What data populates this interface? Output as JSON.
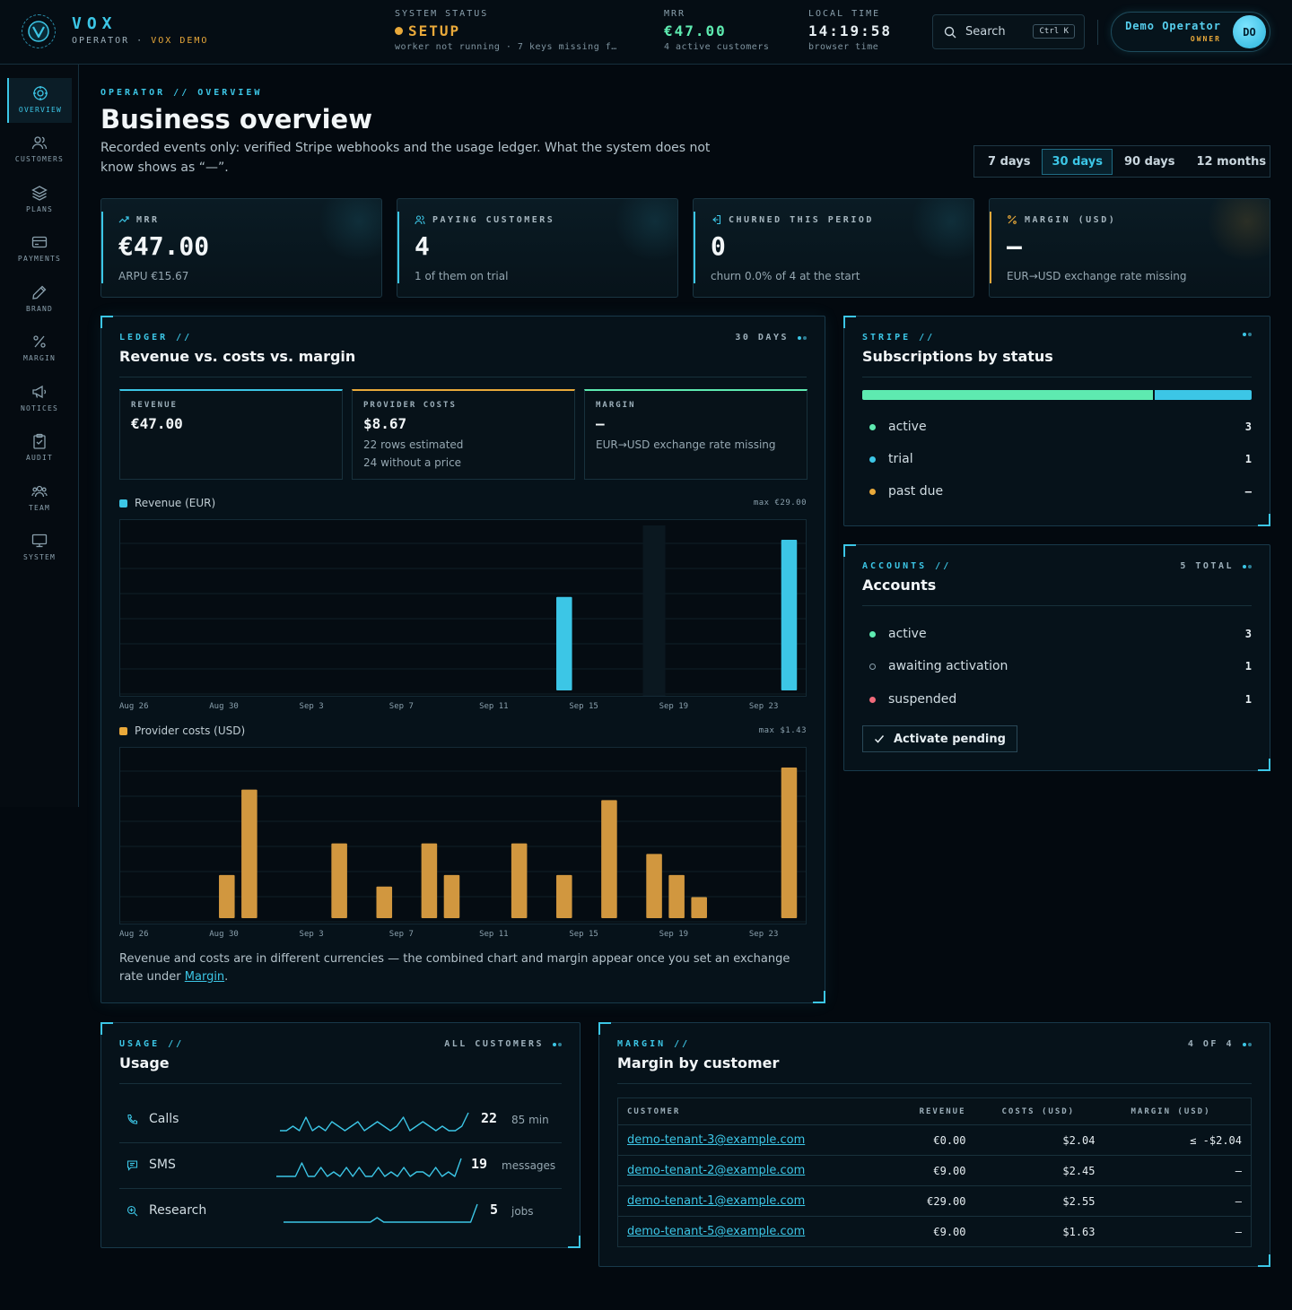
{
  "header": {
    "brand": "VOX",
    "brand_sub_prefix": "OPERATOR ·",
    "brand_sub_demo": "VOX DEMO",
    "system_status": {
      "label": "SYSTEM STATUS",
      "value": "SETUP",
      "sub": "worker not running · 7 keys missing f…",
      "color": "#e9a93a"
    },
    "mrr": {
      "label": "MRR",
      "value": "€47.00",
      "sub": "4 active customers"
    },
    "local_time": {
      "label": "LOCAL TIME",
      "value": "14:19:58",
      "sub": "browser time"
    },
    "search": {
      "label": "Search",
      "shortcut": "Ctrl K"
    },
    "user": {
      "name": "Demo Operator",
      "role": "OWNER",
      "initials": "DO"
    }
  },
  "sidebar": {
    "items": [
      {
        "label": "OVERVIEW",
        "icon": "target-icon",
        "active": true
      },
      {
        "label": "CUSTOMERS",
        "icon": "users-icon"
      },
      {
        "label": "PLANS",
        "icon": "layers-icon"
      },
      {
        "label": "PAYMENTS",
        "icon": "credit-card-icon"
      },
      {
        "label": "BRAND",
        "icon": "pen-icon"
      },
      {
        "label": "MARGIN",
        "icon": "percent-icon"
      },
      {
        "label": "NOTICES",
        "icon": "megaphone-icon"
      },
      {
        "label": "AUDIT",
        "icon": "clipboard-icon"
      },
      {
        "label": "TEAM",
        "icon": "team-icon"
      },
      {
        "label": "SYSTEM",
        "icon": "monitor-icon"
      }
    ]
  },
  "page": {
    "crumb": "OPERATOR // OVERVIEW",
    "title": "Business overview",
    "description": "Recorded events only: verified Stripe webhooks and the usage ledger. What the system does not know shows as “—”.",
    "ranges": [
      "7 days",
      "30 days",
      "90 days",
      "12 months"
    ],
    "active_range": "30 days"
  },
  "kpis": [
    {
      "label": "MRR",
      "value": "€47.00",
      "sub": "ARPU €15.67",
      "icon": "trend-up-icon"
    },
    {
      "label": "PAYING CUSTOMERS",
      "value": "4",
      "sub": "1 of them on trial",
      "icon": "users-icon"
    },
    {
      "label": "CHURNED THIS PERIOD",
      "value": "0",
      "sub": "churn 0.0% of 4 at the start",
      "icon": "logout-icon"
    },
    {
      "label": "MARGIN (USD)",
      "value": "—",
      "sub": "EUR→USD exchange rate missing",
      "icon": "percent-icon"
    }
  ],
  "ledger": {
    "caption": "LEDGER //",
    "title": "Revenue vs. costs vs. margin",
    "period": "30 DAYS",
    "revenue": {
      "label": "REVENUE",
      "value": "€47.00",
      "color": "#3cc6e6"
    },
    "costs": {
      "label": "PROVIDER COSTS",
      "value": "$8.67",
      "sub1": "22 rows estimated",
      "sub2": "24 without a price",
      "color": "#e9a93a"
    },
    "margin": {
      "label": "MARGIN",
      "value": "—",
      "sub1": "EUR→USD exchange rate missing",
      "color": "#5eeab0"
    },
    "note_text": "Revenue and costs are in different currencies — the combined chart and margin appear once you set an exchange rate under",
    "note_link": "Margin",
    "note_end": "."
  },
  "chart_data": [
    {
      "type": "bar",
      "title": "Revenue (EUR)",
      "max_label": "max €29.00",
      "color": "#3cc6e6",
      "ylim": [
        0,
        29
      ],
      "x": [
        "Aug 26",
        "Aug 27",
        "Aug 28",
        "Aug 29",
        "Aug 30",
        "Aug 31",
        "Sep 1",
        "Sep 2",
        "Sep 3",
        "Sep 4",
        "Sep 5",
        "Sep 6",
        "Sep 7",
        "Sep 8",
        "Sep 9",
        "Sep 10",
        "Sep 11",
        "Sep 12",
        "Sep 13",
        "Sep 14",
        "Sep 15",
        "Sep 16",
        "Sep 17",
        "Sep 18",
        "Sep 19",
        "Sep 20",
        "Sep 21",
        "Sep 22",
        "Sep 23",
        "Sep 24"
      ],
      "values": [
        0,
        0,
        0,
        0,
        0,
        0,
        0,
        0,
        0,
        0,
        0,
        0,
        0,
        0,
        0,
        0,
        0,
        0,
        0,
        18,
        0,
        0,
        0,
        0,
        0,
        0,
        0,
        0,
        0,
        29
      ],
      "xticks": [
        "Aug 26",
        "Aug 30",
        "Sep 3",
        "Sep 7",
        "Sep 11",
        "Sep 15",
        "Sep 19",
        "Sep 23"
      ]
    },
    {
      "type": "bar",
      "title": "Provider costs (USD)",
      "max_label": "max $1.43",
      "color": "#d1973f",
      "ylim": [
        0,
        1.43
      ],
      "x": [
        "Aug 26",
        "Aug 27",
        "Aug 28",
        "Aug 29",
        "Aug 30",
        "Aug 31",
        "Sep 1",
        "Sep 2",
        "Sep 3",
        "Sep 4",
        "Sep 5",
        "Sep 6",
        "Sep 7",
        "Sep 8",
        "Sep 9",
        "Sep 10",
        "Sep 11",
        "Sep 12",
        "Sep 13",
        "Sep 14",
        "Sep 15",
        "Sep 16",
        "Sep 17",
        "Sep 18",
        "Sep 19",
        "Sep 20",
        "Sep 21",
        "Sep 22",
        "Sep 23",
        "Sep 24"
      ],
      "values": [
        0,
        0,
        0,
        0,
        0.41,
        1.22,
        0,
        0,
        0,
        0.71,
        0,
        0.3,
        0,
        0.71,
        0.41,
        0,
        0,
        0.71,
        0,
        0.41,
        0,
        1.12,
        0,
        0.61,
        0.41,
        0.2,
        0,
        0,
        0,
        1.43
      ],
      "xticks": [
        "Aug 26",
        "Aug 30",
        "Sep 3",
        "Sep 7",
        "Sep 11",
        "Sep 15",
        "Sep 19",
        "Sep 23"
      ]
    }
  ],
  "subscriptions": {
    "caption": "STRIPE //",
    "title": "Subscriptions by status",
    "rows": [
      {
        "label": "active",
        "count": "3",
        "color": "#5eeab0"
      },
      {
        "label": "trial",
        "count": "1",
        "color": "#3cc6e6"
      },
      {
        "label": "past due",
        "count": "—",
        "color": "#e9a93a"
      }
    ],
    "bar": [
      {
        "label": "active",
        "value": 3,
        "color": "#5eeab0"
      },
      {
        "label": "trial",
        "value": 1,
        "color": "#3cc6e6"
      }
    ]
  },
  "accounts": {
    "caption": "ACCOUNTS //",
    "title": "Accounts",
    "total": "5 TOTAL",
    "rows": [
      {
        "label": "active",
        "count": "3",
        "color": "#5eeab0"
      },
      {
        "label": "awaiting activation",
        "count": "1",
        "color": "#8aa0ad"
      },
      {
        "label": "suspended",
        "count": "1",
        "color": "#f06a7a"
      }
    ],
    "action": "Activate pending"
  },
  "usage": {
    "caption": "USAGE //",
    "title": "Usage",
    "scope": "ALL CUSTOMERS",
    "rows": [
      {
        "label": "Calls",
        "value": "22",
        "unit": "85 min",
        "icon": "phone-icon",
        "spark": [
          0,
          0,
          1,
          0,
          3,
          0,
          1,
          0,
          2,
          1,
          0,
          1,
          2,
          0,
          1,
          2,
          1,
          0,
          1,
          3,
          0,
          1,
          2,
          1,
          0,
          1,
          0,
          0,
          1,
          4
        ]
      },
      {
        "label": "SMS",
        "value": "19",
        "unit": "messages",
        "icon": "chat-icon",
        "spark": [
          0,
          0,
          0,
          0,
          3,
          0,
          0,
          2,
          0,
          1,
          0,
          2,
          0,
          2,
          0,
          0,
          2,
          0,
          1,
          0,
          2,
          0,
          1,
          1,
          0,
          2,
          0,
          1,
          0,
          4
        ]
      },
      {
        "label": "Research",
        "value": "5",
        "unit": "jobs",
        "icon": "search-doc-icon",
        "spark": [
          0,
          0,
          0,
          0,
          0,
          0,
          0,
          0,
          0,
          0,
          0,
          0,
          0,
          0,
          1,
          0,
          0,
          0,
          0,
          0,
          0,
          0,
          0,
          0,
          0,
          0,
          0,
          0,
          0,
          4
        ]
      }
    ]
  },
  "margin_by_customer": {
    "caption": "MARGIN //",
    "title": "Margin by customer",
    "count": "4 OF 4",
    "columns": [
      "CUSTOMER",
      "REVENUE",
      "COSTS (USD)",
      "MARGIN (USD)"
    ],
    "rows": [
      {
        "customer": "demo-tenant-3@example.com",
        "revenue": "€0.00",
        "costs": "$2.04",
        "margin": "≤ -$2.04"
      },
      {
        "customer": "demo-tenant-2@example.com",
        "revenue": "€9.00",
        "costs": "$2.45",
        "margin": "—"
      },
      {
        "customer": "demo-tenant-1@example.com",
        "revenue": "€29.00",
        "costs": "$2.55",
        "margin": "—"
      },
      {
        "customer": "demo-tenant-5@example.com",
        "revenue": "€9.00",
        "costs": "$1.63",
        "margin": "—"
      }
    ]
  }
}
